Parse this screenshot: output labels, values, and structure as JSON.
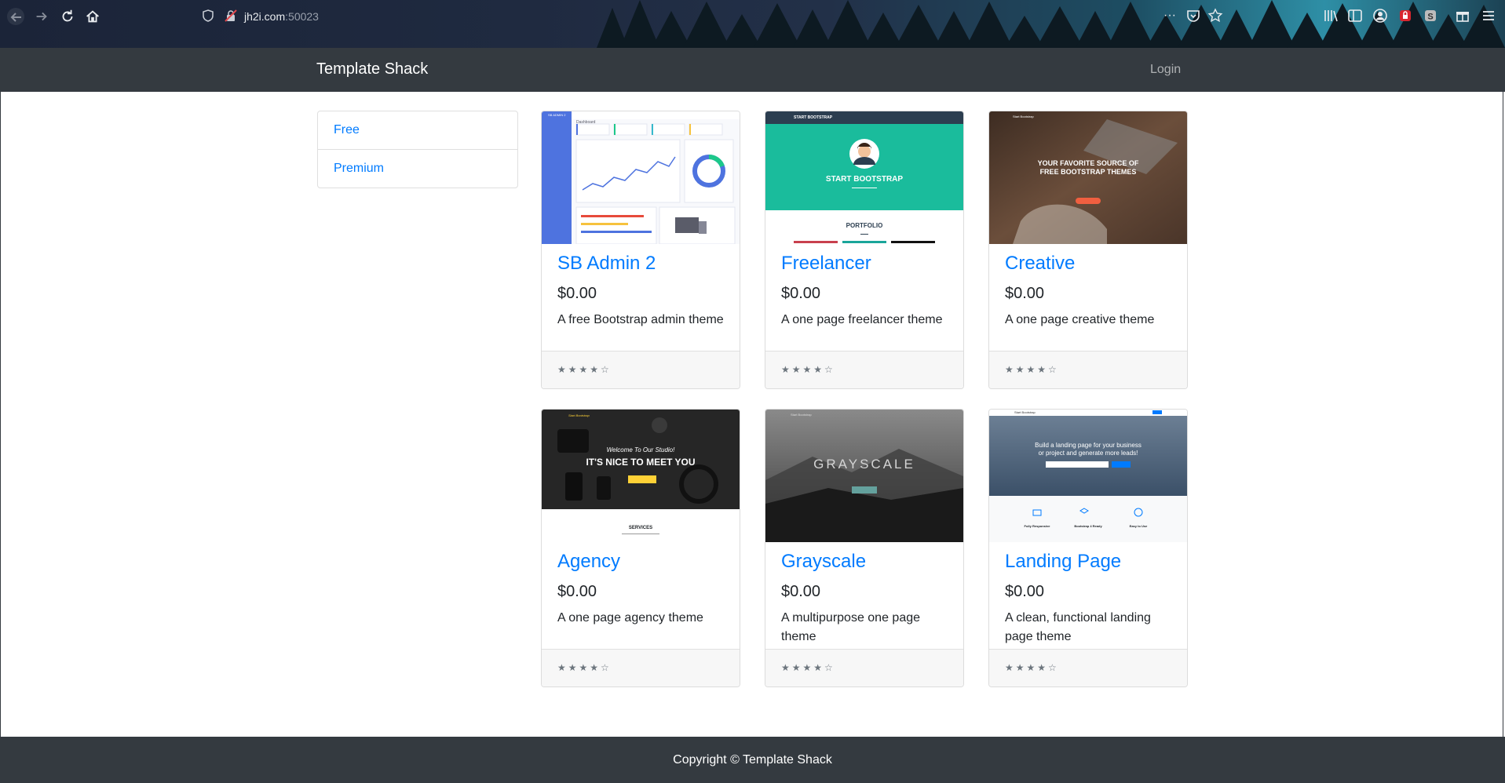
{
  "browser": {
    "url_host": "jh2i.com",
    "url_port": ":50023",
    "icons": [
      "back-icon",
      "forward-icon",
      "reload-icon",
      "home-icon",
      "shield-icon",
      "insecure-lock-icon",
      "more-icon",
      "pocket-icon",
      "star-icon",
      "library-icon",
      "sidebar-icon",
      "account-icon",
      "extension-icon",
      "extension-s-icon",
      "menu-icon"
    ]
  },
  "navbar": {
    "brand": "Template Shack",
    "login": "Login"
  },
  "sidebar": {
    "items": [
      {
        "label": "Free"
      },
      {
        "label": "Premium"
      }
    ]
  },
  "cards": [
    {
      "title": "SB Admin 2",
      "price": "$0.00",
      "description": "A free Bootstrap admin theme",
      "stars": "★★★★☆",
      "rating": 4
    },
    {
      "title": "Freelancer",
      "price": "$0.00",
      "description": "A one page freelancer theme",
      "stars": "★★★★☆",
      "rating": 4
    },
    {
      "title": "Creative",
      "price": "$0.00",
      "description": "A one page creative theme",
      "stars": "★★★★☆",
      "rating": 4
    },
    {
      "title": "Agency",
      "price": "$0.00",
      "description": "A one page agency theme",
      "stars": "★★★★☆",
      "rating": 4
    },
    {
      "title": "Grayscale",
      "price": "$0.00",
      "description": "A multipurpose one page theme",
      "stars": "★★★★☆",
      "rating": 4
    },
    {
      "title": "Landing Page",
      "price": "$0.00",
      "description": "A clean, functional landing page theme",
      "stars": "★★★★☆",
      "rating": 4
    }
  ],
  "thumbnails": {
    "sb_admin": {
      "brand": "SB ADMIN 2",
      "heading": "Dashboard"
    },
    "freelancer": {
      "nav": "START BOOTSTRAP",
      "hero": "START BOOTSTRAP",
      "section": "PORTFOLIO"
    },
    "creative": {
      "nav": "Start Bootstrap",
      "hero_line1": "YOUR FAVORITE SOURCE OF",
      "hero_line2": "FREE BOOTSTRAP THEMES"
    },
    "agency": {
      "nav": "Start Bootstrap",
      "welcome": "Welcome To Our Studio!",
      "hero": "IT'S NICE TO MEET YOU",
      "section": "SERVICES"
    },
    "grayscale": {
      "nav": "Start Bootstrap",
      "hero": "GRAYSCALE"
    },
    "landing": {
      "nav": "Start Bootstrap",
      "hero_line1": "Build a landing page for your business",
      "hero_line2": "or project and generate more leads!",
      "feature1": "Fully Responsive",
      "feature2": "Bootstrap 4 Ready",
      "feature3": "Easy to Use"
    }
  },
  "footer": {
    "copyright": "Copyright © Template Shack"
  },
  "colors": {
    "navbar": "#343a40",
    "link": "#007bff",
    "teal": "#1abc9c"
  }
}
